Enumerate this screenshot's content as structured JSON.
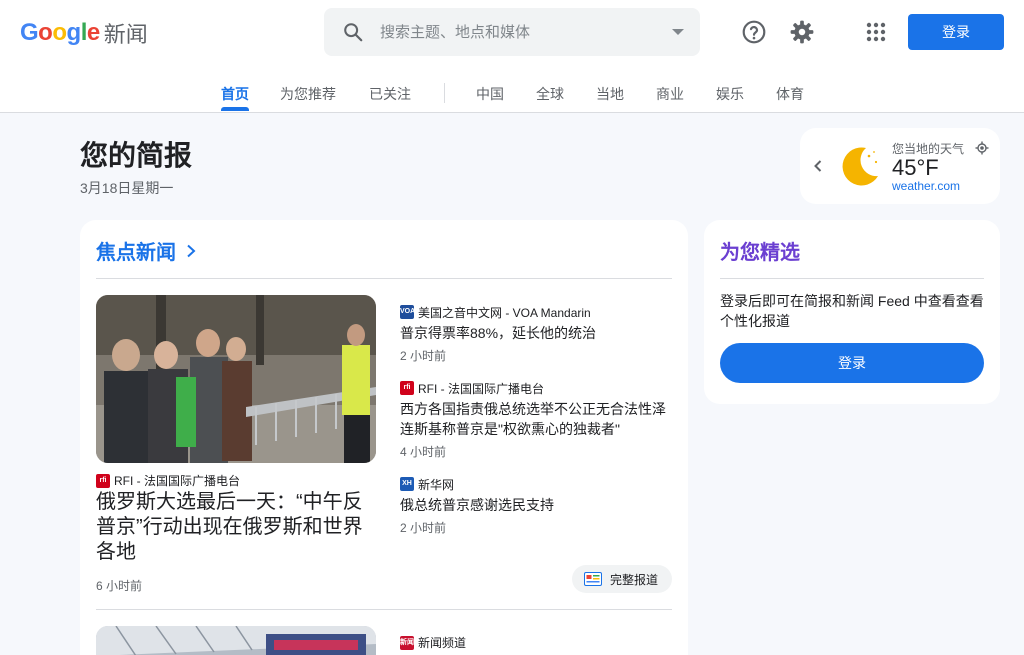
{
  "header": {
    "logo_text": "Google",
    "logo_suffix": "新闻",
    "search_placeholder": "搜索主题、地点和媒体",
    "signin_label": "登录"
  },
  "nav": {
    "tabs": [
      {
        "label": "首页",
        "active": true
      },
      {
        "label": "为您推荐"
      },
      {
        "label": "已关注"
      },
      {
        "label": "中国"
      },
      {
        "label": "全球"
      },
      {
        "label": "当地"
      },
      {
        "label": "商业"
      },
      {
        "label": "娱乐"
      },
      {
        "label": "体育"
      }
    ]
  },
  "briefing": {
    "title": "您的简报",
    "date": "3月18日星期一"
  },
  "weather": {
    "label": "您当地的天气",
    "temp": "45°F",
    "source": "weather.com"
  },
  "top_stories": {
    "title": "焦点新闻",
    "lead": {
      "source": "RFI - 法国国际广播电台",
      "title": "俄罗斯大选最后一天：“中午反普京”行动出现在俄罗斯和世界各地",
      "time": "6 小时前"
    },
    "stories": [
      {
        "source": "美国之音中文网 - VOA Mandarin",
        "title": "普京得票率88%，延长他的统治",
        "time": "2 小时前"
      },
      {
        "source": "RFI - 法国国际广播电台",
        "title": "西方各国指责俄总统选举不公正无合法性泽连斯基称普京是\"权欲熏心的独裁者\"",
        "time": "4 小时前"
      },
      {
        "source": "新华网",
        "title": "俄总统普京感谢选民支持",
        "time": "2 小时前"
      }
    ],
    "full_coverage": "完整报道",
    "second": {
      "source": "新闻频道"
    }
  },
  "picks": {
    "title": "为您精选",
    "desc": "登录后即可在简报和新闻 Feed 中查看查看个性化报道",
    "signin_label": "登录"
  },
  "colors": {
    "accent": "#1a73e8",
    "picks_title": "#6b3fd1",
    "moon": "#f5b400"
  }
}
